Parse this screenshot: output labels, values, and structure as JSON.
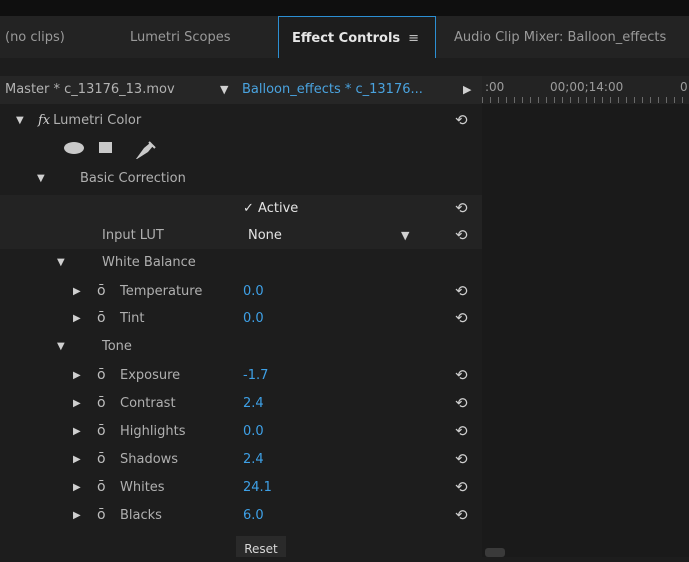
{
  "tabs": [
    {
      "label": "(no clips)"
    },
    {
      "label": "Lumetri Scopes"
    },
    {
      "label": "Effect Controls"
    },
    {
      "label": "Audio Clip Mixer: Balloon_effects"
    }
  ],
  "header": {
    "master": "Master * c_13176_13.mov",
    "sequence": "Balloon_effects * c_13176...",
    "timecodes": [
      ":00",
      "00;00;14:00",
      "0"
    ]
  },
  "effect": {
    "name": "Lumetri Color",
    "section": "Basic Correction",
    "active_label": "Active",
    "input_lut_label": "Input LUT",
    "input_lut_value": "None",
    "white_balance": "White Balance",
    "temperature": {
      "label": "Temperature",
      "value": "0.0"
    },
    "tint": {
      "label": "Tint",
      "value": "0.0"
    },
    "tone": "Tone",
    "exposure": {
      "label": "Exposure",
      "value": "-1.7"
    },
    "contrast": {
      "label": "Contrast",
      "value": "2.4"
    },
    "highlights": {
      "label": "Highlights",
      "value": "0.0"
    },
    "shadows": {
      "label": "Shadows",
      "value": "2.4"
    },
    "whites": {
      "label": "Whites",
      "value": "24.1"
    },
    "blacks": {
      "label": "Blacks",
      "value": "6.0"
    },
    "reset_label": "Reset"
  },
  "glyphs": {
    "menu": "≡",
    "down": "▼",
    "right": "▶",
    "reset": "⟲",
    "stopwatch": "ō",
    "check": "✓",
    "fx": "fx"
  },
  "colors": {
    "accent": "#2c8fd3",
    "value_blue": "#3ea0e6"
  }
}
